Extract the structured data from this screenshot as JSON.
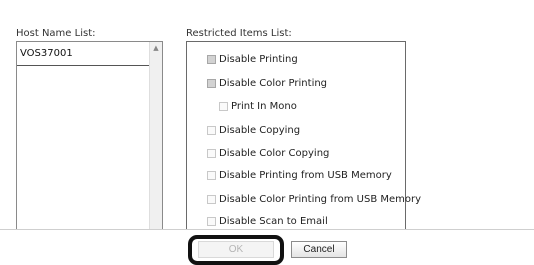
{
  "labels": {
    "host": "Host Name List:",
    "restricted": "Restricted Items List:"
  },
  "host_list": {
    "items": [
      "VOS37001"
    ]
  },
  "restricted_items": [
    {
      "label": "Disable Printing",
      "state": "disabled-checked"
    },
    {
      "label": "Disable Color Printing",
      "state": "disabled-checked"
    },
    {
      "label": "Print In Mono",
      "state": "unchecked"
    },
    {
      "label": "Disable Copying",
      "state": "unchecked"
    },
    {
      "label": "Disable Color Copying",
      "state": "unchecked"
    },
    {
      "label": "Disable Printing from USB Memory",
      "state": "unchecked"
    },
    {
      "label": "Disable Color Printing from USB Memory",
      "state": "unchecked"
    },
    {
      "label": "Disable Scan to Email",
      "state": "unchecked"
    }
  ],
  "buttons": {
    "ok": "OK",
    "cancel": "Cancel"
  },
  "icons": {
    "scroll_up": "scroll-up-arrow-icon"
  },
  "colors": {
    "highlight": "#111111",
    "disabled_text": "#b5b5b5"
  }
}
